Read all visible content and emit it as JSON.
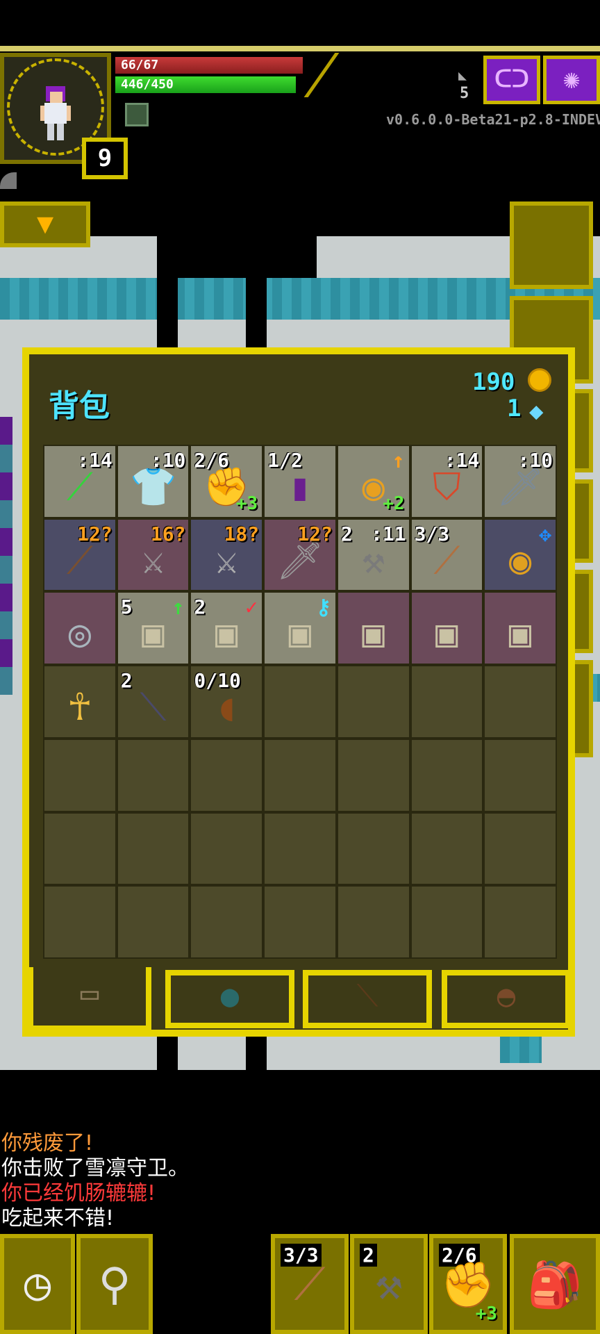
{
  "hud": {
    "hp": "66/67",
    "xp": "446/450",
    "level": "9",
    "depth": "5",
    "version": "v0.6.0.0-Beta21-p2.8-INDEV",
    "journal_icon": "journal-icon",
    "menu_icon": "menu-icon"
  },
  "inventory": {
    "title": "背包",
    "gold": "190",
    "energy": "1",
    "slots": [
      {
        "icon": "green-wand-icon",
        "glyph": "⟋",
        "color": "#34d43c",
        "bg": "grey",
        "qty": ":14"
      },
      {
        "icon": "cloth-armor-icon",
        "glyph": "👕",
        "color": "#ffffff",
        "bg": "grey",
        "qty": ":10"
      },
      {
        "icon": "gloves-icon",
        "glyph": "✊",
        "color": "#222222",
        "bg": "grey",
        "qty": "2/6",
        "qty_left": true,
        "bonus": "+3"
      },
      {
        "icon": "spellbook-icon",
        "glyph": "▮",
        "color": "#6a1f8f",
        "bg": "grey",
        "qty": "1/2",
        "qty_left": true
      },
      {
        "icon": "ring-upgrade-icon",
        "glyph": "◉",
        "color": "#e8a020",
        "bg": "grey",
        "bonus": "+2",
        "mark": "↑",
        "mark_color": "#ffa020"
      },
      {
        "icon": "shield-icon",
        "glyph": "⛉",
        "color": "#d9482a",
        "bg": "grey",
        "qty": ":14"
      },
      {
        "icon": "dagger-icon",
        "glyph": "🗡",
        "color": "#7a8a9a",
        "bg": "grey",
        "qty": ":10"
      },
      {
        "icon": "spear-icon",
        "glyph": "⟋",
        "color": "#7a5030",
        "bg": "blue",
        "qty": "12?",
        "orange": true
      },
      {
        "icon": "sword-icon",
        "glyph": "⚔",
        "color": "#a0a0a0",
        "bg": "pink",
        "qty": "16?",
        "orange": true
      },
      {
        "icon": "greatsword-icon",
        "glyph": "⚔",
        "color": "#b0b0b0",
        "bg": "blue",
        "qty": "18?",
        "orange": true
      },
      {
        "icon": "shortsword-icon",
        "glyph": "🗡",
        "color": "#9a9a9a",
        "bg": "pink",
        "qty": "12?",
        "orange": true
      },
      {
        "icon": "hammer-icon",
        "glyph": "⚒",
        "color": "#7a7a7a",
        "bg": "grey",
        "qty": ":11",
        "qty_left_extra": "2"
      },
      {
        "icon": "throwing-spear-icon",
        "glyph": "⟋",
        "color": "#b07040",
        "bg": "grey",
        "qty": "3/3",
        "qty_left": true
      },
      {
        "icon": "ring-ruby-icon",
        "glyph": "◉",
        "color": "#e0a020",
        "bg": "blue",
        "mark": "✥",
        "mark_color": "#1e8cff"
      },
      {
        "icon": "eye-stone-icon",
        "glyph": "◎",
        "color": "#a8b4bc",
        "bg": "pink"
      },
      {
        "icon": "scroll-upgrade-icon",
        "glyph": "▣",
        "color": "#c9c2a4",
        "bg": "grey",
        "qty": "5",
        "qty_left": true,
        "mark": "↑",
        "mark_color": "#3ddc40"
      },
      {
        "icon": "scroll-mark-icon",
        "glyph": "▣",
        "color": "#c9c2a4",
        "bg": "grey",
        "qty": "2",
        "qty_left": true,
        "mark": "✓",
        "mark_color": "#ff3040"
      },
      {
        "icon": "scroll-key-icon",
        "glyph": "▣",
        "color": "#c9c2a4",
        "bg": "grey",
        "mark": "⚷",
        "mark_color": "#40e0ff"
      },
      {
        "icon": "scroll-arrow-icon",
        "glyph": "▣",
        "color": "#c9c2a4",
        "bg": "pink"
      },
      {
        "icon": "scroll-r-icon",
        "glyph": "▣",
        "color": "#c9c2a4",
        "bg": "pink"
      },
      {
        "icon": "scroll-n-icon",
        "glyph": "▣",
        "color": "#c9c2a4",
        "bg": "pink"
      },
      {
        "icon": "ankh-icon",
        "glyph": "☥",
        "color": "#f2c040",
        "bg": ""
      },
      {
        "icon": "dart-icon",
        "glyph": "⟍",
        "color": "#4a4a6a",
        "bg": "",
        "qty": "2",
        "qty_left": true
      },
      {
        "icon": "waterskin-icon",
        "glyph": "◖",
        "color": "#8a4a18",
        "bg": "",
        "qty": "0/10",
        "qty_left": true
      },
      {
        "icon": "",
        "glyph": "",
        "bg": ""
      },
      {
        "icon": "",
        "glyph": "",
        "bg": ""
      },
      {
        "icon": "",
        "glyph": "",
        "bg": ""
      },
      {
        "icon": "",
        "glyph": "",
        "bg": ""
      },
      {
        "icon": "",
        "glyph": "",
        "bg": ""
      },
      {
        "icon": "",
        "glyph": "",
        "bg": ""
      },
      {
        "icon": "",
        "glyph": "",
        "bg": ""
      },
      {
        "icon": "",
        "glyph": "",
        "bg": ""
      },
      {
        "icon": "",
        "glyph": "",
        "bg": ""
      },
      {
        "icon": "",
        "glyph": "",
        "bg": ""
      },
      {
        "icon": "",
        "glyph": "",
        "bg": ""
      },
      {
        "icon": "",
        "glyph": "",
        "bg": ""
      },
      {
        "icon": "",
        "glyph": "",
        "bg": ""
      },
      {
        "icon": "",
        "glyph": "",
        "bg": ""
      },
      {
        "icon": "",
        "glyph": "",
        "bg": ""
      },
      {
        "icon": "",
        "glyph": "",
        "bg": ""
      },
      {
        "icon": "",
        "glyph": "",
        "bg": ""
      },
      {
        "icon": "",
        "glyph": "",
        "bg": ""
      },
      {
        "icon": "",
        "glyph": "",
        "bg": ""
      },
      {
        "icon": "",
        "glyph": "",
        "bg": ""
      },
      {
        "icon": "",
        "glyph": "",
        "bg": ""
      },
      {
        "icon": "",
        "glyph": "",
        "bg": ""
      },
      {
        "icon": "",
        "glyph": "",
        "bg": ""
      },
      {
        "icon": "",
        "glyph": "",
        "bg": ""
      },
      {
        "icon": "",
        "glyph": "",
        "bg": ""
      }
    ],
    "tabs": [
      {
        "name": "tab-backpack",
        "icon": "backpack-icon",
        "glyph": "▭",
        "color": "#8a7a5a"
      },
      {
        "name": "tab-seed-pouch",
        "icon": "seed-pouch-icon",
        "glyph": "●",
        "color": "#2a6a6a"
      },
      {
        "name": "tab-wand-holster",
        "icon": "wand-holster-icon",
        "glyph": "⟍",
        "color": "#5a3a1a"
      },
      {
        "name": "tab-food-bag",
        "icon": "food-bag-icon",
        "glyph": "◓",
        "color": "#7a4a2a"
      }
    ]
  },
  "log": [
    {
      "text": "你残废了!",
      "color": "#ff9a3a"
    },
    {
      "text": "你击败了雪凛守卫。",
      "color": "#ffffff"
    },
    {
      "text": "你已经饥肠辘辘!",
      "color": "#ff3a3a"
    },
    {
      "text": "吃起来不错!",
      "color": "#ffffff"
    }
  ],
  "toolbar": {
    "wait_icon": "clock-icon",
    "search_icon": "magnifier-icon",
    "quickslots": [
      {
        "qty": "3/3",
        "icon": "throwing-spear-icon",
        "glyph": "⟋",
        "color": "#b07040"
      },
      {
        "qty": "2",
        "icon": "hammer-icon",
        "glyph": "⚒",
        "color": "#6a6a6a"
      },
      {
        "qty": "2/6",
        "icon": "gloves-icon",
        "glyph": "✊",
        "color": "#222222",
        "bonus": "+3"
      }
    ],
    "backpack_icon": "backpack-icon"
  },
  "colors": {
    "frame": "#e6d400",
    "panel": "#3d3a17",
    "accent": "#4de3ff"
  }
}
